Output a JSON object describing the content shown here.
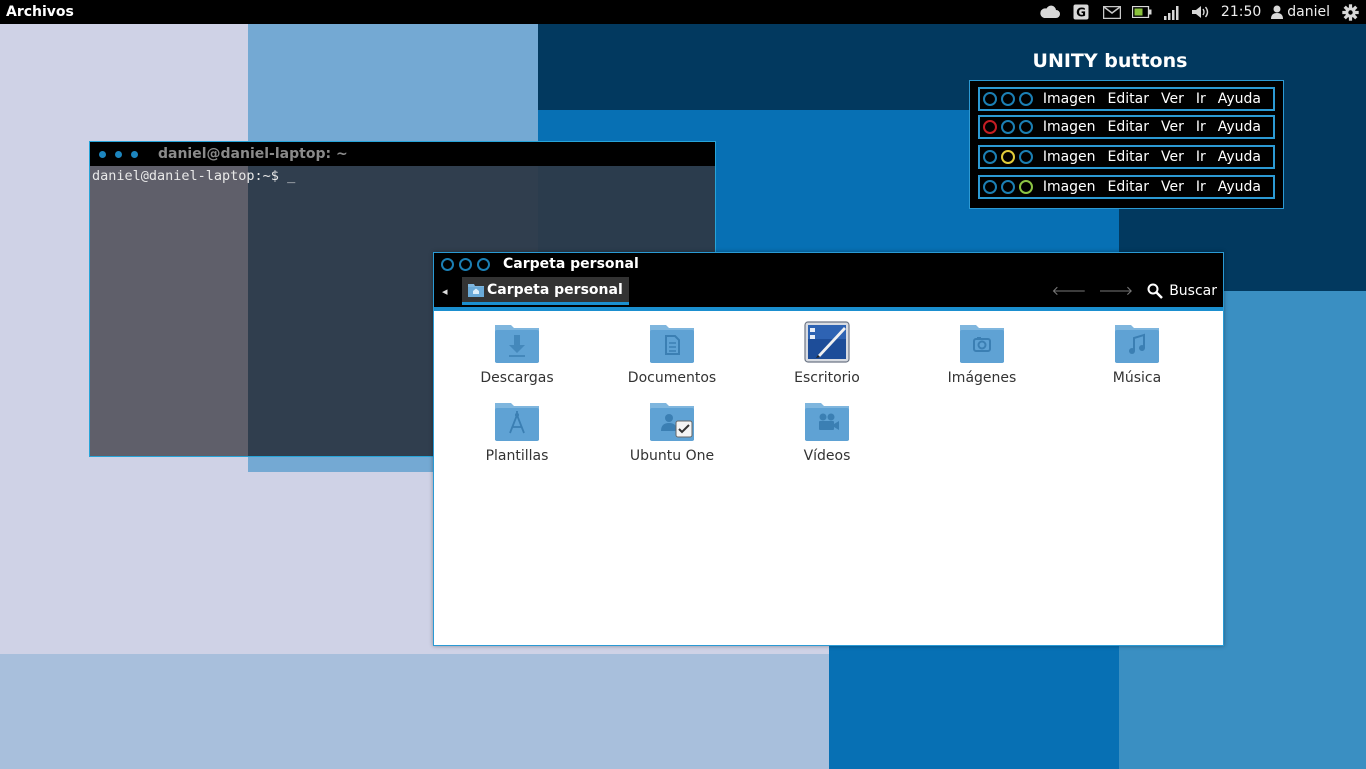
{
  "top_panel": {
    "app_name": "Archivos",
    "indicators": [
      "cloud-icon",
      "g-icon",
      "mail-icon",
      "battery-icon",
      "signal-icon",
      "volume-icon"
    ],
    "clock": "21:50",
    "user": "daniel",
    "settings_icon": "gear-icon"
  },
  "unity_widget": {
    "title": "UNITY buttons",
    "rows": [
      {
        "circles": [
          "blue",
          "blue",
          "blue"
        ]
      },
      {
        "circles": [
          "red",
          "blue",
          "blue"
        ]
      },
      {
        "circles": [
          "blue",
          "yellow",
          "blue"
        ]
      },
      {
        "circles": [
          "blue",
          "blue",
          "green"
        ]
      }
    ],
    "menus": [
      "Imagen",
      "Editar",
      "Ver",
      "Ir",
      "Ayuda"
    ]
  },
  "terminal": {
    "title": "daniel@daniel-laptop: ~",
    "prompt": "daniel@daniel-laptop:~$ _"
  },
  "file_manager": {
    "title": "Carpeta personal",
    "breadcrumb": "Carpeta personal",
    "search_label": "Buscar",
    "items": [
      {
        "label": "Descargas",
        "icon": "download-folder-icon"
      },
      {
        "label": "Documentos",
        "icon": "documents-folder-icon"
      },
      {
        "label": "Escritorio",
        "icon": "desktop-icon"
      },
      {
        "label": "Imágenes",
        "icon": "pictures-folder-icon"
      },
      {
        "label": "Música",
        "icon": "music-folder-icon"
      },
      {
        "label": "Plantillas",
        "icon": "templates-folder-icon"
      },
      {
        "label": "Ubuntu One",
        "icon": "ubuntu-one-folder-icon"
      },
      {
        "label": "Vídeos",
        "icon": "videos-folder-icon"
      }
    ]
  },
  "colors": {
    "accent": "#1b8fcf",
    "panel_bg": "#000000",
    "wallpaper_dark": "#02395f",
    "wallpaper_mid": "#0770b4",
    "wallpaper_light": "#74a9d3"
  }
}
